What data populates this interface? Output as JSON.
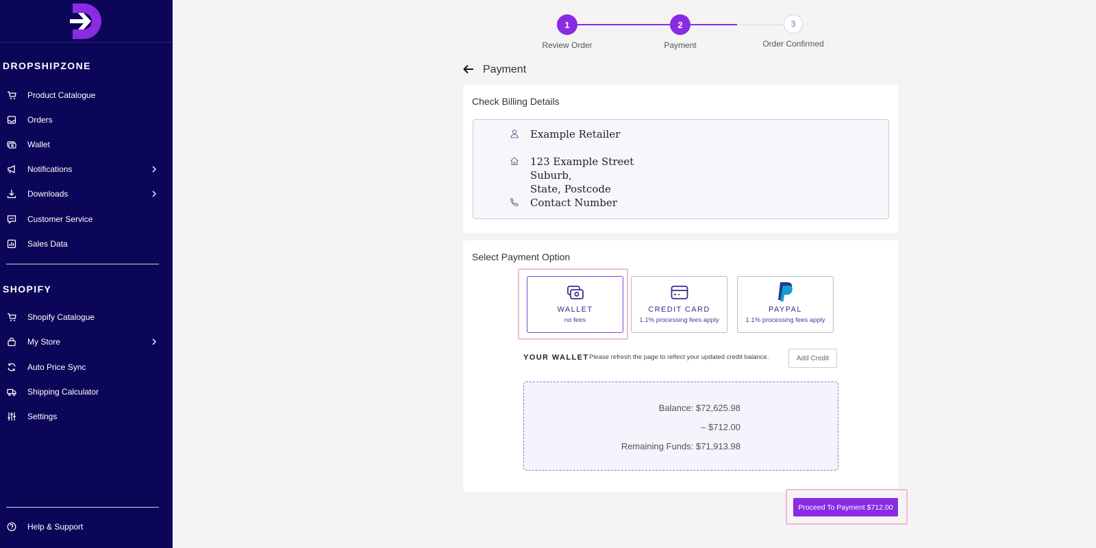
{
  "sidebar": {
    "sections": [
      {
        "title": "DROPSHIPZONE",
        "items": [
          {
            "label": "Product Catalogue",
            "icon": "cart-icon"
          },
          {
            "label": "Orders",
            "icon": "inbox-icon"
          },
          {
            "label": "Wallet",
            "icon": "wallet-icon"
          },
          {
            "label": "Notifications",
            "icon": "megaphone-icon",
            "has_submenu": true
          },
          {
            "label": "Downloads",
            "icon": "download-icon",
            "has_submenu": true
          },
          {
            "label": "Customer Service",
            "icon": "chat-icon"
          },
          {
            "label": "Sales Data",
            "icon": "bar-chart-icon"
          }
        ]
      },
      {
        "title": "SHOPIFY",
        "items": [
          {
            "label": "Shopify Catalogue",
            "icon": "cart-icon"
          },
          {
            "label": "My Store",
            "icon": "bag-icon",
            "has_submenu": true
          },
          {
            "label": "Auto Price Sync",
            "icon": "sync-icon"
          },
          {
            "label": "Shipping Calculator",
            "icon": "truck-icon"
          },
          {
            "label": "Settings",
            "icon": "sliders-icon"
          }
        ]
      }
    ],
    "footer_item": {
      "label": "Help & Support",
      "icon": "help-icon"
    }
  },
  "stepper": {
    "steps": [
      {
        "number": "1",
        "label": "Review Order",
        "state": "complete"
      },
      {
        "number": "2",
        "label": "Payment",
        "state": "active"
      },
      {
        "number": "3",
        "label": "Order Confirmed",
        "state": "pending"
      }
    ]
  },
  "page": {
    "title": "Payment"
  },
  "billing": {
    "heading": "Check Billing Details",
    "name": "Example Retailer",
    "address_line1": "123 Example Street",
    "address_line2": "Suburb,",
    "address_line3": "State, Postcode",
    "contact": "Contact Number"
  },
  "payment": {
    "heading": "Select Payment Option",
    "options": [
      {
        "name": "WALLET",
        "sub": "no fees",
        "icon": "wallet-icon",
        "selected": true
      },
      {
        "name": "CREDIT CARD",
        "sub": "1.1% processing fees apply",
        "icon": "credit-card-icon",
        "selected": false
      },
      {
        "name": "PAYPAL",
        "sub": "1.1% processing fees apply",
        "icon": "paypal-icon",
        "selected": false
      }
    ]
  },
  "wallet": {
    "heading": "YOUR WALLET",
    "note": "Please refresh the page to reflect your updated credit balance.",
    "add_credit_label": "Add Credit",
    "balance": "Balance: $72,625.98",
    "deduction": "– $712.00",
    "remaining": "Remaining Funds: $71,913.98"
  },
  "actions": {
    "proceed_label": "Proceed To Payment $712.00"
  },
  "colors": {
    "sidebar_bg": "#0b0658",
    "accent": "#8a2be2",
    "page_bg": "#f4f4f4",
    "highlight": "#efb9d7"
  }
}
